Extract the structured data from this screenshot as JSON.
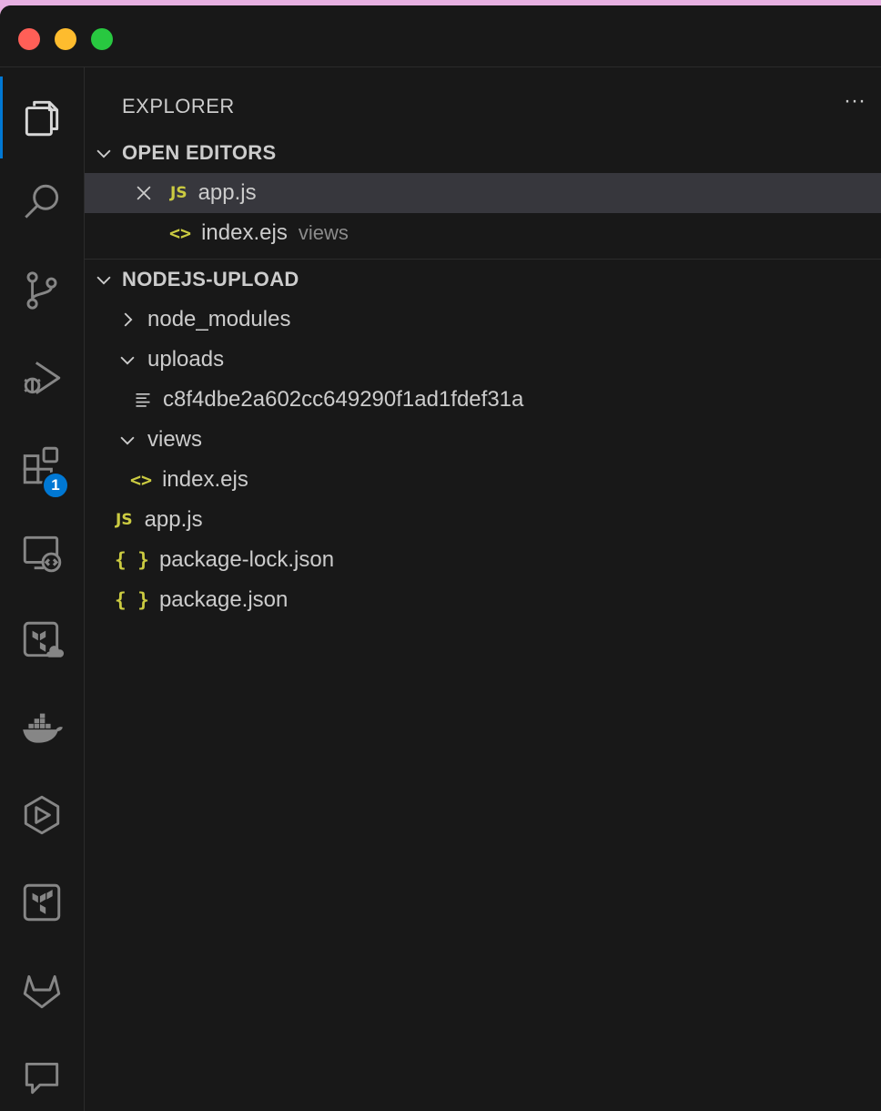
{
  "sidebar": {
    "title": "EXPLORER",
    "more_label": "···",
    "open_editors": {
      "label": "OPEN EDITORS",
      "items": [
        {
          "name": "app.js",
          "icon": "js-file-icon",
          "description": ""
        },
        {
          "name": "index.ejs",
          "icon": "code-file-icon",
          "description": "views"
        }
      ]
    },
    "workspace": {
      "label": "NODEJS-UPLOAD",
      "tree": [
        {
          "name": "node_modules",
          "type": "folder",
          "expanded": false
        },
        {
          "name": "uploads",
          "type": "folder",
          "expanded": true
        },
        {
          "name": "c8f4dbe2a602cc649290f1ad1fdef31a",
          "type": "file",
          "icon": "text-file-icon"
        },
        {
          "name": "views",
          "type": "folder",
          "expanded": true
        },
        {
          "name": "index.ejs",
          "type": "file",
          "icon": "code-file-icon"
        },
        {
          "name": "app.js",
          "type": "file",
          "icon": "js-file-icon"
        },
        {
          "name": "package-lock.json",
          "type": "file",
          "icon": "json-file-icon"
        },
        {
          "name": "package.json",
          "type": "file",
          "icon": "json-file-icon"
        }
      ]
    }
  },
  "activity_bar": {
    "extensions_badge": "1",
    "icons": [
      "explorer-icon",
      "search-icon",
      "source-control-icon",
      "run-debug-icon",
      "extensions-icon",
      "remote-explorer-icon",
      "terraform-cloud-icon",
      "docker-icon",
      "play-icon",
      "terraform-icon",
      "gitlab-icon",
      "comments-icon"
    ]
  },
  "glyphs": {
    "js": "JS",
    "code": "<>",
    "json": "{ }"
  },
  "colors": {
    "accent": "#0078d4",
    "selection": "#37373d",
    "file_icon": "#cbcb41"
  }
}
